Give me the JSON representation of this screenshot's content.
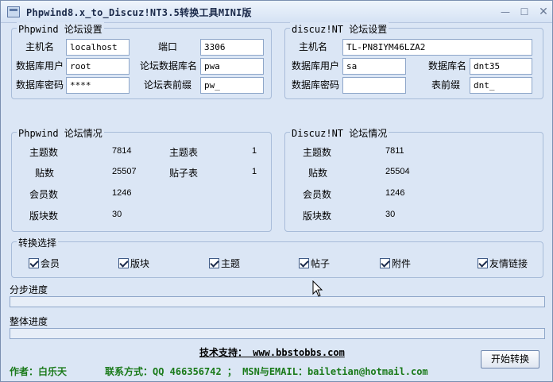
{
  "window": {
    "title": "Phpwind8.x_to_Discuz!NT3.5转换工具MINI版",
    "min": "—",
    "max": "☐",
    "close": "✕"
  },
  "pw_settings": {
    "title": "Phpwind 论坛设置",
    "host_label": "主机名",
    "host_value": "localhost",
    "port_label": "端口",
    "port_value": "3306",
    "user_label": "数据库用户",
    "user_value": "root",
    "dbname_label": "论坛数据库名",
    "dbname_value": "pwa",
    "pwd_label": "数据库密码",
    "pwd_value": "****",
    "prefix_label": "论坛表前缀",
    "prefix_value": "pw_"
  },
  "dz_settings": {
    "title": "discuz!NT 论坛设置",
    "host_label": "主机名",
    "host_value": "TL-PN8IYM46LZA2",
    "user_label": "数据库用户",
    "user_value": "sa",
    "dbname_label": "数据库名",
    "dbname_value": "dnt35",
    "pwd_label": "数据库密码",
    "pwd_value": "",
    "prefix_label": "表前缀",
    "prefix_value": "dnt_"
  },
  "pw_stats": {
    "title": "Phpwind 论坛情况",
    "topics_label": "主题数",
    "topics_value": "7814",
    "topic_table_label": "主题表",
    "topic_table_value": "1",
    "posts_label": "贴数",
    "posts_value": "25507",
    "post_table_label": "贴子表",
    "post_table_value": "1",
    "members_label": "会员数",
    "members_value": "1246",
    "boards_label": "版块数",
    "boards_value": "30"
  },
  "dz_stats": {
    "title": "Discuz!NT 论坛情况",
    "topics_label": "主题数",
    "topics_value": "7811",
    "posts_label": "贴数",
    "posts_value": "25504",
    "members_label": "会员数",
    "members_value": "1246",
    "boards_label": "版块数",
    "boards_value": "30"
  },
  "convert": {
    "title": "转换选择",
    "options": [
      "会员",
      "版块",
      "主题",
      "帖子",
      "附件",
      "友情链接"
    ]
  },
  "progress": {
    "step_label": "分步进度",
    "overall_label": "整体进度",
    "step": 0,
    "overall": 0
  },
  "footer": {
    "support": "技术支持： www.bbstobbs.com",
    "author": "作者：白乐天",
    "contact": "联系方式：QQ 466356742 ； MSN与EMAIL：bailetian@hotmail.com",
    "start_button": "开始转换"
  }
}
